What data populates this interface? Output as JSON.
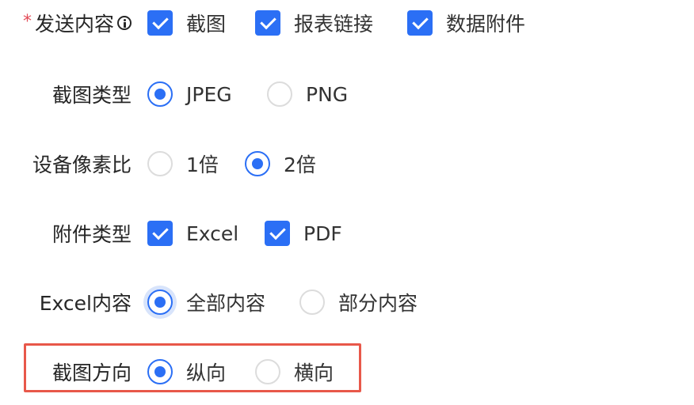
{
  "colors": {
    "accent": "#2b6ff5",
    "required": "#e34d59",
    "highlight": "#e8584a"
  },
  "send_content": {
    "label": "发送内容",
    "required_mark": "*",
    "info_icon": "info-circle-icon",
    "options": [
      {
        "label": "截图",
        "checked": true
      },
      {
        "label": "报表链接",
        "checked": true
      },
      {
        "label": "数据附件",
        "checked": true
      }
    ]
  },
  "screenshot_type": {
    "label": "截图类型",
    "options": [
      {
        "label": "JPEG",
        "selected": true
      },
      {
        "label": "PNG",
        "selected": false
      }
    ]
  },
  "pixel_ratio": {
    "label": "设备像素比",
    "options": [
      {
        "label": "1倍",
        "selected": false
      },
      {
        "label": "2倍",
        "selected": true
      }
    ]
  },
  "attachment_type": {
    "label": "附件类型",
    "options": [
      {
        "label": "Excel",
        "checked": true
      },
      {
        "label": "PDF",
        "checked": true
      }
    ]
  },
  "excel_content": {
    "label": "Excel内容",
    "options": [
      {
        "label": "全部内容",
        "selected": true
      },
      {
        "label": "部分内容",
        "selected": false
      }
    ]
  },
  "screenshot_orientation": {
    "label": "截图方向",
    "options": [
      {
        "label": "纵向",
        "selected": true
      },
      {
        "label": "横向",
        "selected": false
      }
    ]
  }
}
